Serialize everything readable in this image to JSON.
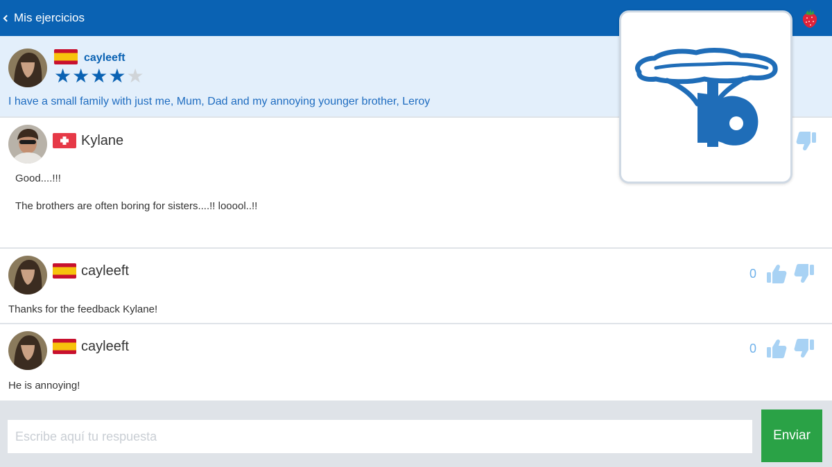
{
  "header": {
    "back_label": "Mis ejercicios",
    "icon": "strawberry-icon"
  },
  "original": {
    "username": "cayleeft",
    "flag": "spain-flag",
    "rating": 4,
    "rating_max": 5,
    "text": "I have a small family with just me, Mum, Dad and my annoying younger brother, Leroy"
  },
  "comments": [
    {
      "username": "Kylane",
      "flag": "switzerland-flag",
      "lines": [
        "Good....!!!",
        "The brothers are often boring for sisters....!! looool..!!"
      ]
    },
    {
      "username": "cayleeft",
      "flag": "spain-flag",
      "votes": "0",
      "text": "Thanks for the feedback Kylane!"
    },
    {
      "username": "cayleeft",
      "flag": "spain-flag",
      "votes": "0",
      "text": "He is annoying!"
    }
  ],
  "logo": {
    "letter": "b"
  },
  "footer": {
    "placeholder": "Escribe aquí tu respuesta",
    "send_label": "Enviar"
  },
  "colors": {
    "header": "#0a62b3",
    "accent": "#1e6cc0",
    "send": "#2aa246",
    "thumb": "#a8d2f4"
  }
}
